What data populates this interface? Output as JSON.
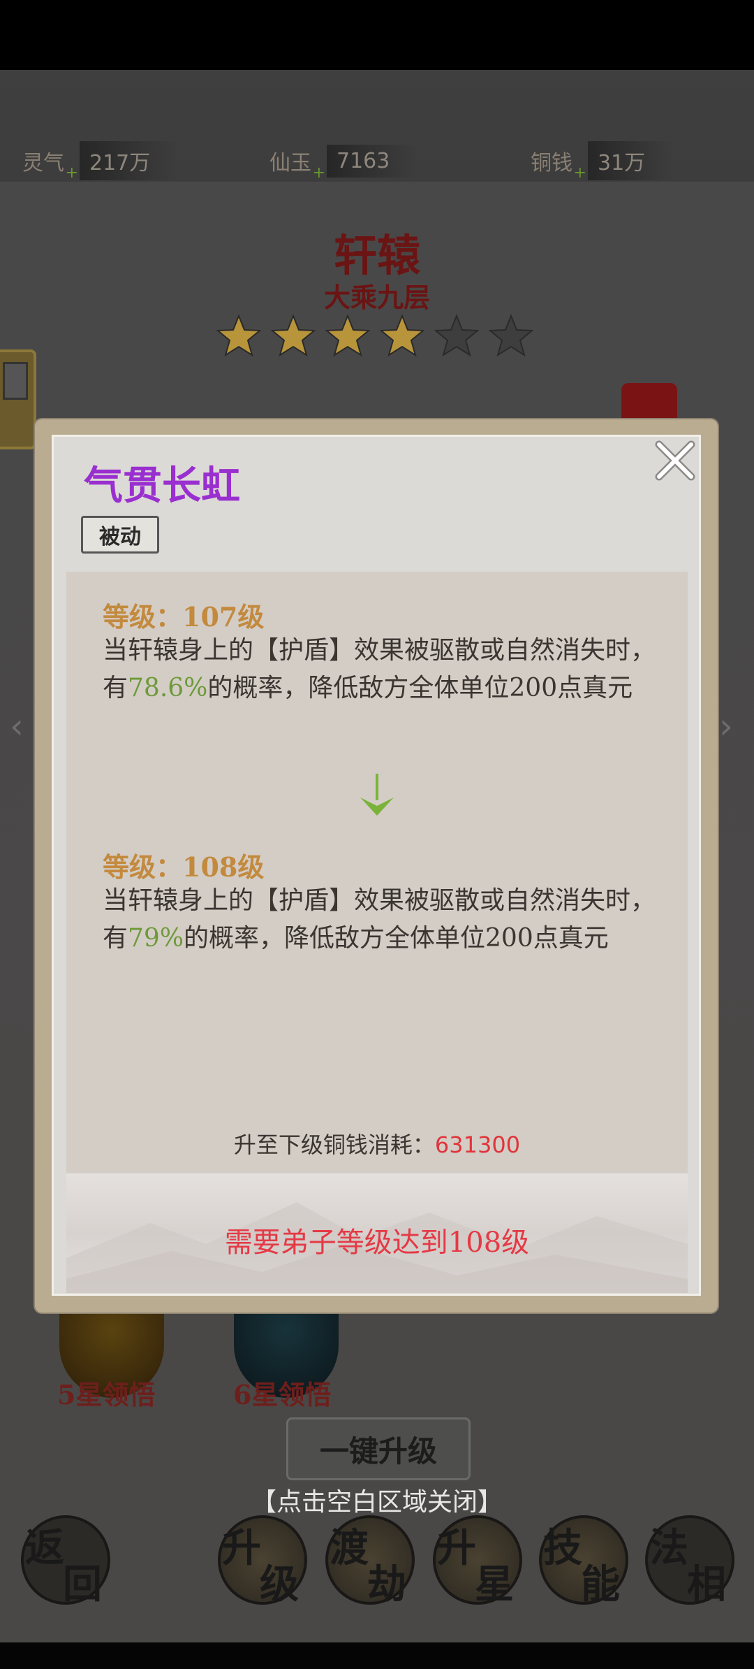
{
  "resources": [
    {
      "name": "灵气",
      "value": "217万"
    },
    {
      "name": "仙玉",
      "value": "7163"
    },
    {
      "name": "铜钱",
      "value": "31万"
    }
  ],
  "hero": {
    "name": "轩辕",
    "realm": "大乘九层",
    "stars_filled": 4,
    "stars_total": 6
  },
  "popup": {
    "title": "气贯长虹",
    "type_badge": "被动",
    "current": {
      "level_label": "等级：107级",
      "desc_before": "当轩辕身上的【护盾】效果被驱散或自然消失时，有",
      "chance": "78.6%",
      "desc_after": "的概率，降低敌方全体单位200点真元"
    },
    "next": {
      "level_label": "等级：108级",
      "desc_before": "当轩辕身上的【护盾】效果被驱散或自然消失时，有",
      "chance": "79%",
      "desc_after": "的概率，降低敌方全体单位200点真元"
    },
    "cost_label": "升至下级铜钱消耗：",
    "cost_value": "631300",
    "requirement": "需要弟子等级达到108级"
  },
  "background": {
    "orb_labels": [
      "5星领悟",
      "6星领悟"
    ],
    "upgrade_all": "一键升级",
    "close_hint": "【点击空白区域关闭】",
    "nav": [
      {
        "chars": [
          "返",
          "回"
        ]
      },
      {
        "chars": [
          "升",
          "级"
        ]
      },
      {
        "chars": [
          "渡",
          "劫"
        ]
      },
      {
        "chars": [
          "升",
          "星"
        ]
      },
      {
        "chars": [
          "技",
          "能"
        ]
      },
      {
        "chars": [
          "法",
          "相"
        ]
      }
    ]
  },
  "colors": {
    "title": "#9a2fd0",
    "level": "#c38a3e",
    "highlight": "#6e9a3a",
    "requirement": "#e43a45",
    "star_filled": "#b8953a",
    "star_empty": "#3e3e3e"
  }
}
